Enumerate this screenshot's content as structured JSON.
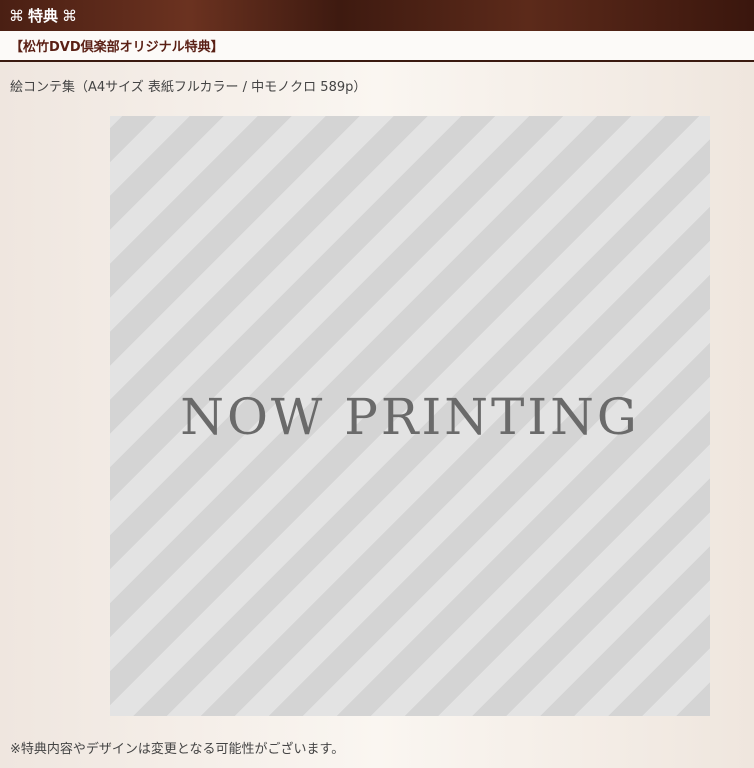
{
  "header": {
    "symbol_left": "⌘",
    "title": "特典",
    "symbol_right": "⌘"
  },
  "subheading": {
    "text": "【松竹DVD倶楽部オリジナル特典】"
  },
  "item": {
    "description": "絵コンテ集（A4サイズ 表紙フルカラー / 中モノクロ 589p）",
    "image_placeholder": "NOW PRINTING"
  },
  "note": {
    "text": "※特典内容やデザインは変更となる可能性がございます。"
  },
  "colors": {
    "header_bg": "#4a1f13",
    "subheading_text": "#5a1f14",
    "divider": "#3a1a10",
    "stripe_dark": "#d4d4d4",
    "stripe_light": "#e3e3e3"
  }
}
